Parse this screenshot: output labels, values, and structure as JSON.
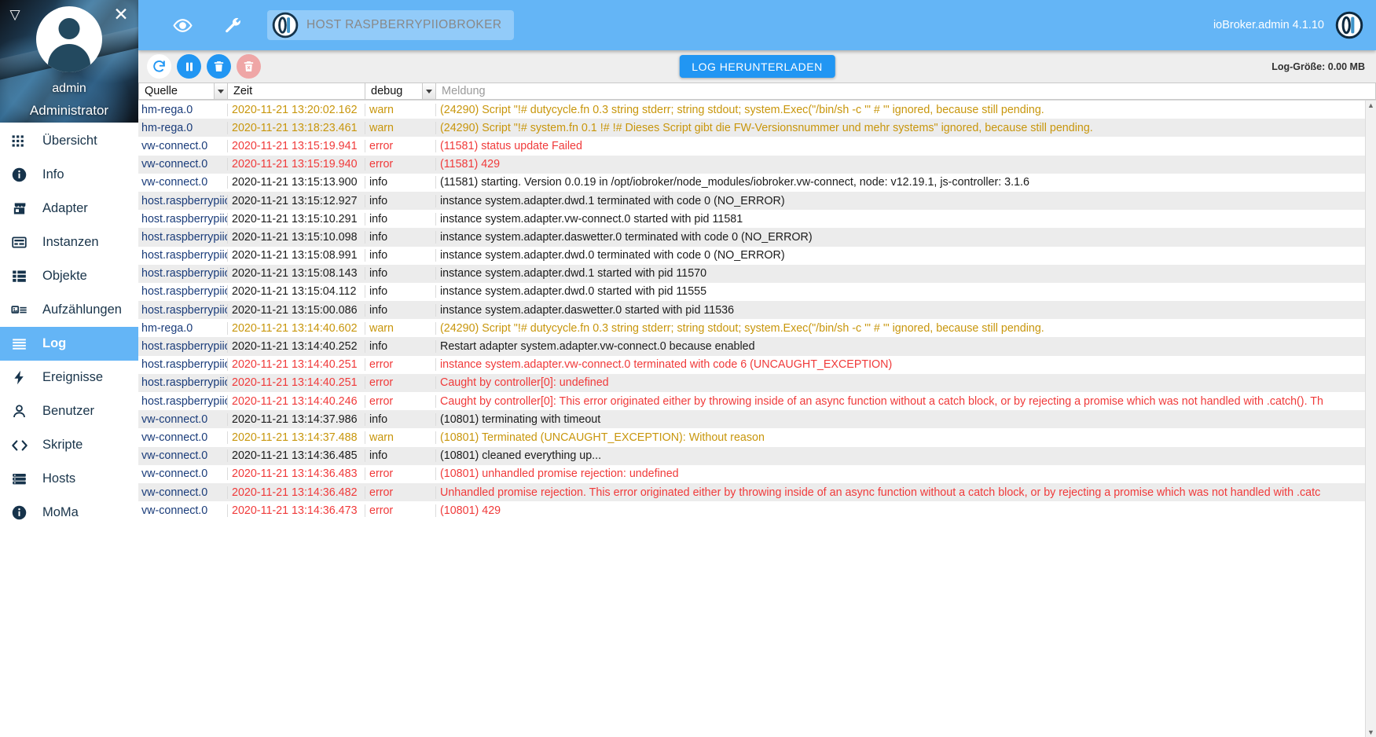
{
  "sidebar": {
    "user": {
      "name": "admin",
      "role": "Administrator"
    },
    "collapse_icon": "triangle-down-icon",
    "close_icon": "close-icon",
    "items": [
      {
        "label": "Übersicht",
        "icon": "grid-icon",
        "active": false
      },
      {
        "label": "Info",
        "icon": "info-icon",
        "active": false
      },
      {
        "label": "Adapter",
        "icon": "store-icon",
        "active": false
      },
      {
        "label": "Instanzen",
        "icon": "instances-icon",
        "active": false
      },
      {
        "label": "Objekte",
        "icon": "table-icon",
        "active": false
      },
      {
        "label": "Aufzählungen",
        "icon": "enum-icon",
        "active": false
      },
      {
        "label": "Log",
        "icon": "list-lines-icon",
        "active": true
      },
      {
        "label": "Ereignisse",
        "icon": "bolt-icon",
        "active": false
      },
      {
        "label": "Benutzer",
        "icon": "user-icon",
        "active": false
      },
      {
        "label": "Skripte",
        "icon": "code-icon",
        "active": false
      },
      {
        "label": "Hosts",
        "icon": "server-icon",
        "active": false
      },
      {
        "label": "MoMa",
        "icon": "info-icon",
        "active": false
      }
    ]
  },
  "topbar": {
    "eye_icon": "eye-icon",
    "wrench_icon": "wrench-icon",
    "host_chip_label": "HOST RASPBERRYPIIOBROKER",
    "host_chip_icon": "iobroker-logo-icon",
    "version": "ioBroker.admin 4.1.10",
    "logo_icon": "iobroker-logo-icon",
    "accent_color": "#64b5f6"
  },
  "toolbar": {
    "buttons": [
      {
        "name": "refresh-button",
        "icon": "refresh-icon",
        "style": "outline",
        "color": "#2196f3"
      },
      {
        "name": "pause-button",
        "icon": "pause-icon",
        "style": "solid",
        "color": "#2196f3"
      },
      {
        "name": "clear-button",
        "icon": "trash-icon",
        "style": "solid",
        "color": "#2196f3"
      },
      {
        "name": "delete-log-button",
        "icon": "trash-x-icon",
        "style": "disabled",
        "color": "#efa6a6"
      }
    ],
    "download_label": "LOG HERUNTERLADEN",
    "log_size": "Log-Größe: 0.00 MB"
  },
  "table": {
    "headers": {
      "source": "Quelle",
      "time": "Zeit",
      "severity": "debug",
      "message_placeholder": "Meldung"
    },
    "severity_options": [
      "debug",
      "info",
      "warn",
      "error"
    ],
    "rows": [
      {
        "source": "hm-rega.0",
        "time": "2020-11-21 13:20:02.162",
        "severity": "warn",
        "message": "(24290) Script \"!# dutycycle.fn 0.3 string stderr; string stdout; system.Exec(\"/bin/sh -c '\" # '\" ignored, because still pending."
      },
      {
        "source": "hm-rega.0",
        "time": "2020-11-21 13:18:23.461",
        "severity": "warn",
        "message": "(24290) Script \"!# system.fn 0.1 !# !# Dieses Script gibt die FW-Versionsnummer und mehr systems\" ignored, because still pending."
      },
      {
        "source": "vw-connect.0",
        "time": "2020-11-21 13:15:19.941",
        "severity": "error",
        "message": "(11581) status update Failed"
      },
      {
        "source": "vw-connect.0",
        "time": "2020-11-21 13:15:19.940",
        "severity": "error",
        "message": "(11581) 429"
      },
      {
        "source": "vw-connect.0",
        "time": "2020-11-21 13:15:13.900",
        "severity": "info",
        "message": "(11581) starting. Version 0.0.19 in /opt/iobroker/node_modules/iobroker.vw-connect, node: v12.19.1, js-controller: 3.1.6"
      },
      {
        "source": "host.raspberrypiiobr",
        "time": "2020-11-21 13:15:12.927",
        "severity": "info",
        "message": "instance system.adapter.dwd.1 terminated with code 0 (NO_ERROR)"
      },
      {
        "source": "host.raspberrypiiobr",
        "time": "2020-11-21 13:15:10.291",
        "severity": "info",
        "message": "instance system.adapter.vw-connect.0 started with pid 11581"
      },
      {
        "source": "host.raspberrypiiobr",
        "time": "2020-11-21 13:15:10.098",
        "severity": "info",
        "message": "instance system.adapter.daswetter.0 terminated with code 0 (NO_ERROR)"
      },
      {
        "source": "host.raspberrypiiobr",
        "time": "2020-11-21 13:15:08.991",
        "severity": "info",
        "message": "instance system.adapter.dwd.0 terminated with code 0 (NO_ERROR)"
      },
      {
        "source": "host.raspberrypiiobr",
        "time": "2020-11-21 13:15:08.143",
        "severity": "info",
        "message": "instance system.adapter.dwd.1 started with pid 11570"
      },
      {
        "source": "host.raspberrypiiobr",
        "time": "2020-11-21 13:15:04.112",
        "severity": "info",
        "message": "instance system.adapter.dwd.0 started with pid 11555"
      },
      {
        "source": "host.raspberrypiiobr",
        "time": "2020-11-21 13:15:00.086",
        "severity": "info",
        "message": "instance system.adapter.daswetter.0 started with pid 11536"
      },
      {
        "source": "hm-rega.0",
        "time": "2020-11-21 13:14:40.602",
        "severity": "warn",
        "message": "(24290) Script \"!# dutycycle.fn 0.3 string stderr; string stdout; system.Exec(\"/bin/sh -c '\" # '\" ignored, because still pending."
      },
      {
        "source": "host.raspberrypiiobr",
        "time": "2020-11-21 13:14:40.252",
        "severity": "info",
        "message": "Restart adapter system.adapter.vw-connect.0 because enabled"
      },
      {
        "source": "host.raspberrypiiobr",
        "time": "2020-11-21 13:14:40.251",
        "severity": "error",
        "message": "instance system.adapter.vw-connect.0 terminated with code 6 (UNCAUGHT_EXCEPTION)"
      },
      {
        "source": "host.raspberrypiiobr",
        "time": "2020-11-21 13:14:40.251",
        "severity": "error",
        "message": "Caught by controller[0]: undefined"
      },
      {
        "source": "host.raspberrypiiobr",
        "time": "2020-11-21 13:14:40.246",
        "severity": "error",
        "message": "Caught by controller[0]: This error originated either by throwing inside of an async function without a catch block, or by rejecting a promise which was not handled with .catch(). Th"
      },
      {
        "source": "vw-connect.0",
        "time": "2020-11-21 13:14:37.986",
        "severity": "info",
        "message": "(10801) terminating with timeout"
      },
      {
        "source": "vw-connect.0",
        "time": "2020-11-21 13:14:37.488",
        "severity": "warn",
        "message": "(10801) Terminated (UNCAUGHT_EXCEPTION): Without reason"
      },
      {
        "source": "vw-connect.0",
        "time": "2020-11-21 13:14:36.485",
        "severity": "info",
        "message": "(10801) cleaned everything up..."
      },
      {
        "source": "vw-connect.0",
        "time": "2020-11-21 13:14:36.483",
        "severity": "error",
        "message": "(10801) unhandled promise rejection: undefined"
      },
      {
        "source": "vw-connect.0",
        "time": "2020-11-21 13:14:36.482",
        "severity": "error",
        "message": "Unhandled promise rejection. This error originated either by throwing inside of an async function without a catch block, or by rejecting a promise which was not handled with .catc"
      },
      {
        "source": "vw-connect.0",
        "time": "2020-11-21 13:14:36.473",
        "severity": "error",
        "message": "(10801) 429"
      }
    ]
  },
  "colors": {
    "accent": "#64b5f6",
    "button_blue": "#2196f3",
    "warn": "#c8960c",
    "error": "#f03a3a",
    "info": "#1b1b1b",
    "source": "#1a3c7a"
  }
}
